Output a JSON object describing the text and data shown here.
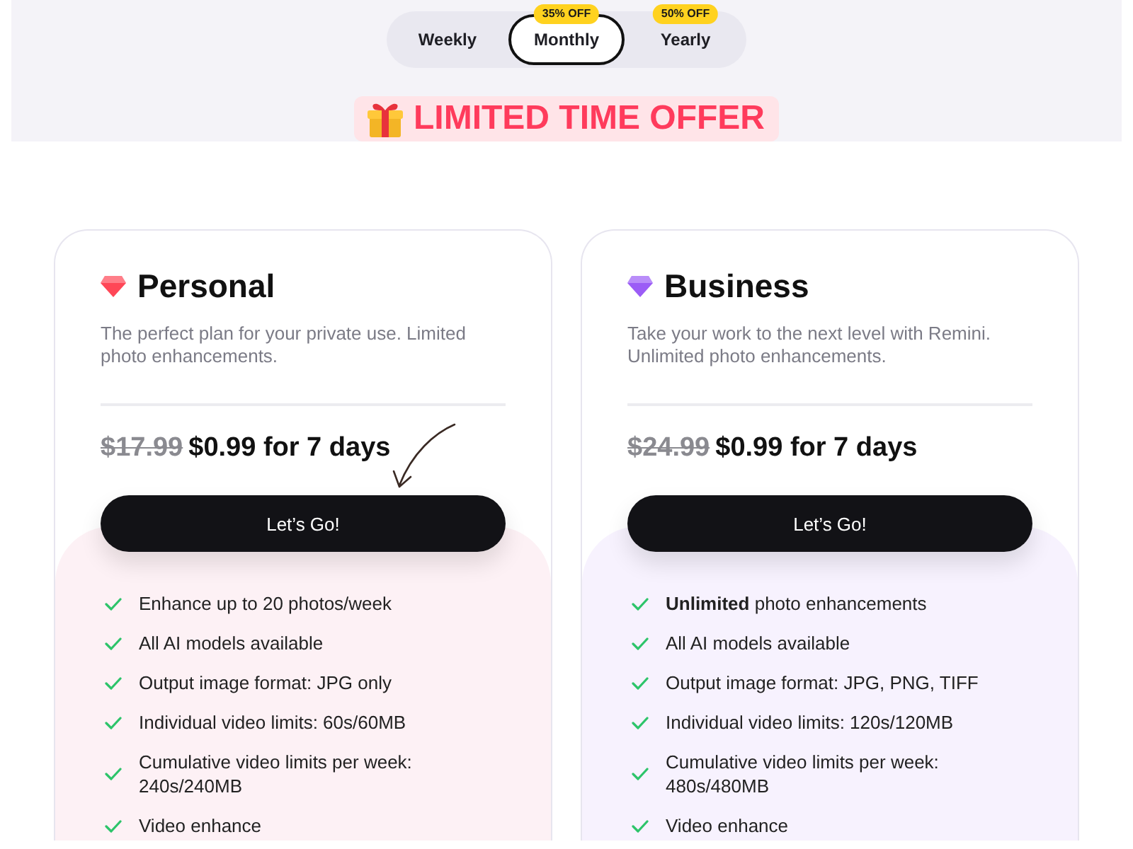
{
  "billing_toggle": {
    "options": [
      {
        "label": "Weekly",
        "selected": false
      },
      {
        "label": "Monthly",
        "selected": true,
        "badge": "35% OFF"
      },
      {
        "label": "Yearly",
        "selected": false,
        "badge": "50% OFF"
      }
    ]
  },
  "promo_banner": {
    "text": "LIMITED TIME OFFER"
  },
  "plans": [
    {
      "name": "Personal",
      "color": "#ff4757",
      "description": "The perfect plan for your private use. Limited photo enhancements.",
      "original_price": "$17.99",
      "offer_price": "$0.99 for 7 days",
      "arrow": true,
      "button": "Let’s Go!",
      "features": [
        "Enhance up to 20 photos/week",
        "All AI models available",
        "Output image format: JPG only",
        "Individual video limits: 60s/60MB",
        "Cumulative video limits per week: 240s/240MB",
        "Video enhance"
      ]
    },
    {
      "name": "Business",
      "color": "#9b5cf6",
      "description": "Take your work to the next level with Remini. Unlimited photo enhancements.",
      "original_price": "$24.99",
      "offer_price": "$0.99 for 7 days",
      "button": "Let’s Go!",
      "features": [
        "**Unlimited** photo enhancements",
        "All AI models available",
        "Output image format: JPG, PNG, TIFF",
        "Individual video limits: 120s/120MB",
        "Cumulative video limits per week: 480s/480MB",
        "Video enhance"
      ]
    }
  ]
}
